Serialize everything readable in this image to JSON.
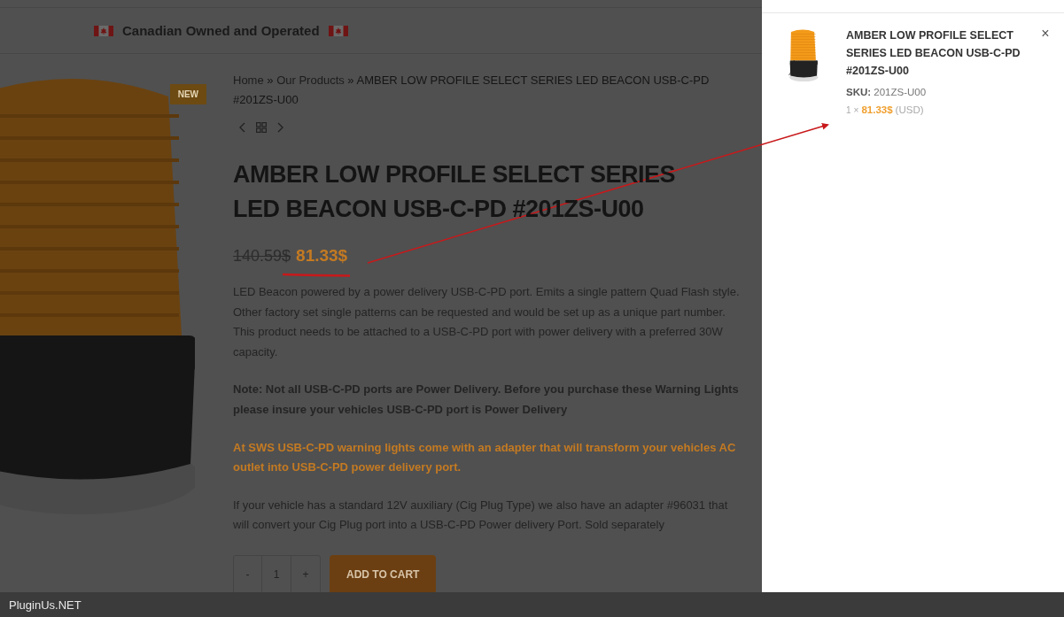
{
  "header": {
    "tagline": "Canadian Owned and Operated"
  },
  "product": {
    "badge": "NEW",
    "separator": "»",
    "breadcrumb": [
      {
        "label": "Home",
        "kind": "link"
      },
      {
        "label": "Our Products",
        "kind": "link"
      },
      {
        "label": "AMBER LOW PROFILE SELECT SERIES LED BEACON USB-C-PD #201ZS-U00",
        "kind": "current"
      }
    ],
    "title": "AMBER LOW PROFILE SELECT SERIES LED BEACON USB-C-PD #201ZS-U00",
    "old_price": "140.59$",
    "price": "81.33$",
    "paragraphs": [
      {
        "kind": "normal",
        "text": "LED Beacon powered by a power delivery USB-C-PD port. Emits a single pattern Quad Flash style. Other factory set single patterns can be requested and would be set up as a unique part number. This product needs to be attached to a USB-C-PD port with power delivery with a preferred 30W capacity."
      },
      {
        "kind": "note",
        "text": "Note: Not all USB-C-PD ports are Power Delivery. Before you purchase these Warning Lights please insure your vehicles USB-C-PD port is Power Delivery"
      },
      {
        "kind": "highlight",
        "text": "At SWS USB-C-PD warning lights come with an adapter that will transform your vehicles AC outlet into USB-C-PD power delivery port."
      },
      {
        "kind": "normal",
        "text": "If your vehicle has a standard 12V auxiliary (Cig Plug Type) we also have an adapter #96031 that will convert your Cig Plug port into a USB-C-PD Power delivery Port. Sold separately"
      }
    ],
    "qty_minus": "-",
    "quantity": "1",
    "qty_plus": "+",
    "add_to_cart": "ADD TO CART"
  },
  "cart": {
    "items": [
      {
        "title": "AMBER LOW PROFILE SELECT SERIES LED BEACON USB-C-PD #201ZS-U00",
        "sku_label": "SKU:",
        "sku": "201ZS-U00",
        "quantity": "1",
        "times": "×",
        "price": "81.33$",
        "currency": "(USD)",
        "remove": "×"
      }
    ]
  },
  "footer": {
    "label": "PluginUs.NET"
  }
}
